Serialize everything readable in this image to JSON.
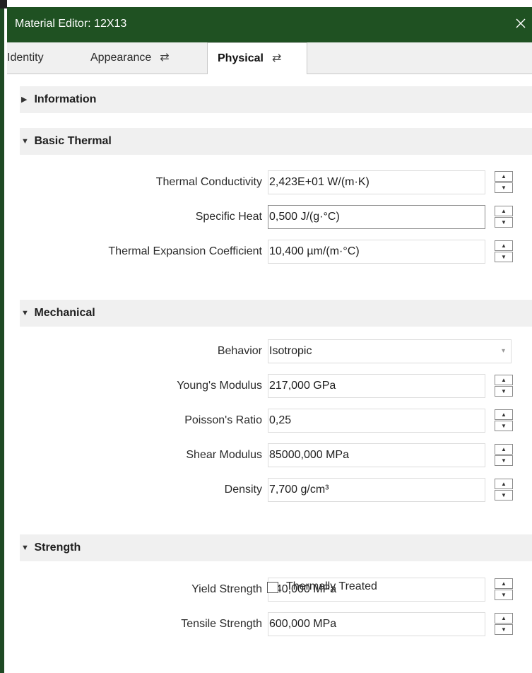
{
  "window": {
    "title": "Material Editor: 12X13",
    "close_glyph": "✕"
  },
  "tabs": [
    {
      "label": "Identity",
      "selected": false,
      "icon": ""
    },
    {
      "label": "Appearance",
      "selected": false,
      "icon": "swap-icon"
    },
    {
      "label": "Physical",
      "selected": true,
      "icon": "swap-icon"
    }
  ],
  "swap_glyph": "⇄",
  "sections": {
    "information": {
      "title": "Information",
      "expanded": false
    },
    "basic_thermal": {
      "title": "Basic Thermal",
      "expanded": true,
      "rows": [
        {
          "label": "Thermal Conductivity",
          "value": "2,423E+01 W/(m·K)"
        },
        {
          "label": "Specific Heat",
          "value": "0,500 J/(g·°C)"
        },
        {
          "label": "Thermal Expansion Coefficient",
          "value": "10,400 µm/(m·°C)"
        }
      ]
    },
    "mechanical": {
      "title": "Mechanical",
      "expanded": true,
      "behavior": {
        "label": "Behavior",
        "value": "Isotropic"
      },
      "rows": [
        {
          "label": "Young's Modulus",
          "value": "217,000 GPa"
        },
        {
          "label": "Poisson's Ratio",
          "value": "0,25"
        },
        {
          "label": "Shear Modulus",
          "value": "85000,000 MPa"
        },
        {
          "label": "Density",
          "value": "7,700 g/cm³"
        }
      ]
    },
    "strength": {
      "title": "Strength",
      "expanded": true,
      "rows": [
        {
          "label": "Yield Strength",
          "value": "440,000 MPa"
        },
        {
          "label": "Tensile Strength",
          "value": "600,000 MPa"
        }
      ],
      "checkbox": {
        "label": "Thermally Treated",
        "checked": false
      }
    }
  },
  "glyphs": {
    "collapsed": "▶",
    "expanded": "▼",
    "up": "▲",
    "down": "▼",
    "dropdown": "▾"
  },
  "colors": {
    "titlebar": "#1f5122",
    "section_bg": "#f0f0f0"
  }
}
